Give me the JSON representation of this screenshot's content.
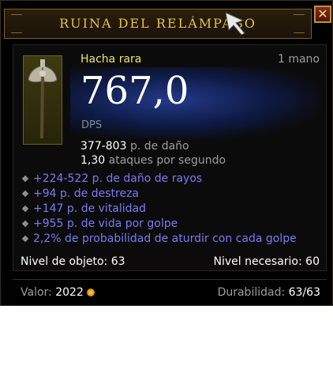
{
  "item": {
    "name": "RUINA DEL RELÁMPAGO",
    "type": "Hacha rara",
    "slot": "1 mano",
    "dps_value": "767,0",
    "dps_label": "DPS",
    "damage_value": "377-803",
    "damage_label": "p. de daño",
    "speed_value": "1,30",
    "speed_label": "ataques por segundo"
  },
  "affixes": [
    "+224-522 p. de daño de rayos",
    "+94 p. de destreza",
    "+147 p. de vitalidad",
    "+955 p. de vida por golpe",
    "2,2% de probabilidad de aturdir con cada golpe"
  ],
  "requirements": {
    "item_level_label": "Nivel de objeto:",
    "item_level": "63",
    "required_level_label": "Nivel necesario:",
    "required_level": "60"
  },
  "footer": {
    "value_label": "Valor:",
    "value": "2022",
    "durability_label": "Durabilidad:",
    "durability": "63/63"
  },
  "close_glyph": "✕",
  "colors": {
    "title": "#e8c24a",
    "rare": "#f2e36a",
    "affix": "#7a7af5",
    "background": "#000000"
  },
  "icons": [
    "axe-item-icon",
    "close-icon",
    "gold-coin-icon",
    "cursor-icon"
  ]
}
